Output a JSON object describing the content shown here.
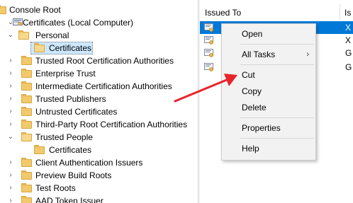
{
  "tree": {
    "items": [
      {
        "label": "Console Root"
      },
      {
        "label": "Certificates (Local Computer)"
      },
      {
        "label": "Personal"
      },
      {
        "label": "Certificates"
      },
      {
        "label": "Trusted Root Certification Authorities"
      },
      {
        "label": "Enterprise Trust"
      },
      {
        "label": "Intermediate Certification Authorities"
      },
      {
        "label": "Trusted Publishers"
      },
      {
        "label": "Untrusted Certificates"
      },
      {
        "label": "Third-Party Root Certification Authorities"
      },
      {
        "label": "Trusted People"
      },
      {
        "label": "Certificates"
      },
      {
        "label": "Client Authentication Issuers"
      },
      {
        "label": "Preview Build Roots"
      },
      {
        "label": "Test Roots"
      },
      {
        "label": "AAD Token Issuer"
      }
    ]
  },
  "list": {
    "columns": [
      "Issued To",
      "Is"
    ],
    "rows": [
      {
        "issuer": "X"
      },
      {
        "issuer": "X"
      },
      {
        "issuer": "G"
      },
      {
        "issuer": "G"
      }
    ]
  },
  "context_menu": {
    "items": [
      "Open",
      "All Tasks",
      "Cut",
      "Copy",
      "Delete",
      "Properties",
      "Help"
    ],
    "submenu_arrow": "›"
  },
  "colors": {
    "selection": "#0078d7",
    "arrow": "#e8242a",
    "folder": "#f2c96b"
  }
}
